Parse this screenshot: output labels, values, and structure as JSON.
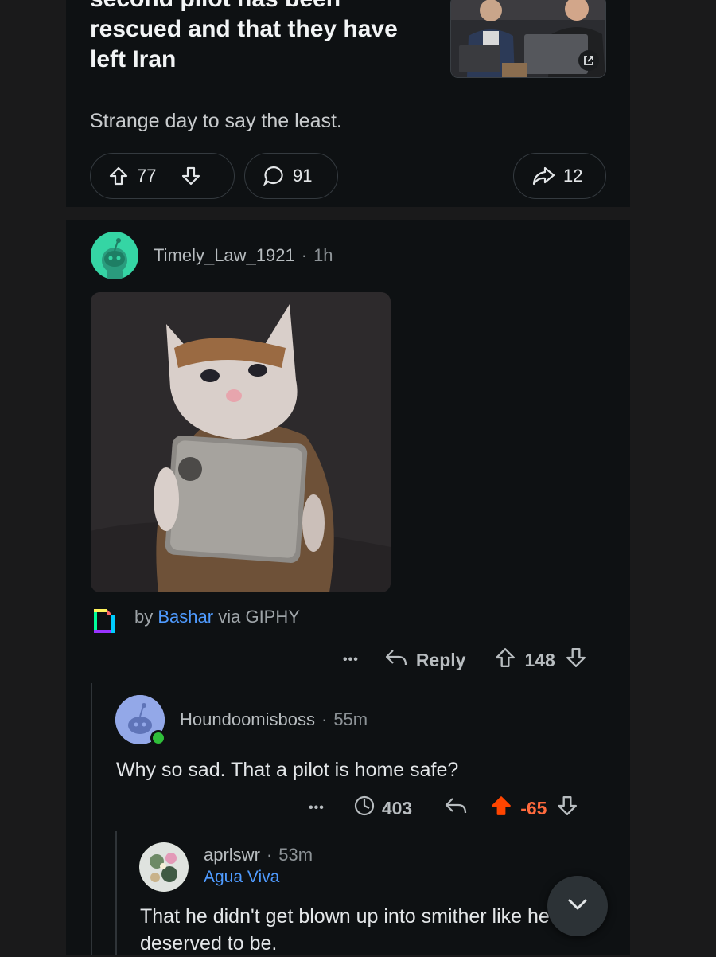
{
  "post": {
    "title": "second pilot has been rescued and that they have left Iran",
    "body": "Strange day to say the least.",
    "upvotes": "77",
    "comments": "91",
    "shares": "12"
  },
  "comment1": {
    "username": "Timely_Law_1921",
    "time": "1h",
    "giphy_by": "by",
    "giphy_author": "Bashar",
    "giphy_via": "via GIPHY",
    "more": "•••",
    "reply_label": "Reply",
    "votes": "148"
  },
  "comment2": {
    "username": "Houndoomisboss",
    "time": "55m",
    "text": "Why so sad. That a pilot is home safe?",
    "more": "•••",
    "award_count": "403",
    "votes": "-65"
  },
  "comment3": {
    "username": "aprlswr",
    "time": "53m",
    "flair": "Agua Viva",
    "text": "That he didn't get blown up into smither like he deserved to be."
  },
  "colors": {
    "upvote_active": "#ff4500",
    "downvoted_score": "#ff6a3d",
    "link": "#4f9bff",
    "online": "#2fbf3a"
  },
  "icons": [
    "upvote-icon",
    "downvote-icon",
    "comment-icon",
    "share-icon",
    "external-link-icon",
    "reply-icon",
    "award-icon",
    "more-icon",
    "chevron-down-icon",
    "giphy-icon"
  ]
}
